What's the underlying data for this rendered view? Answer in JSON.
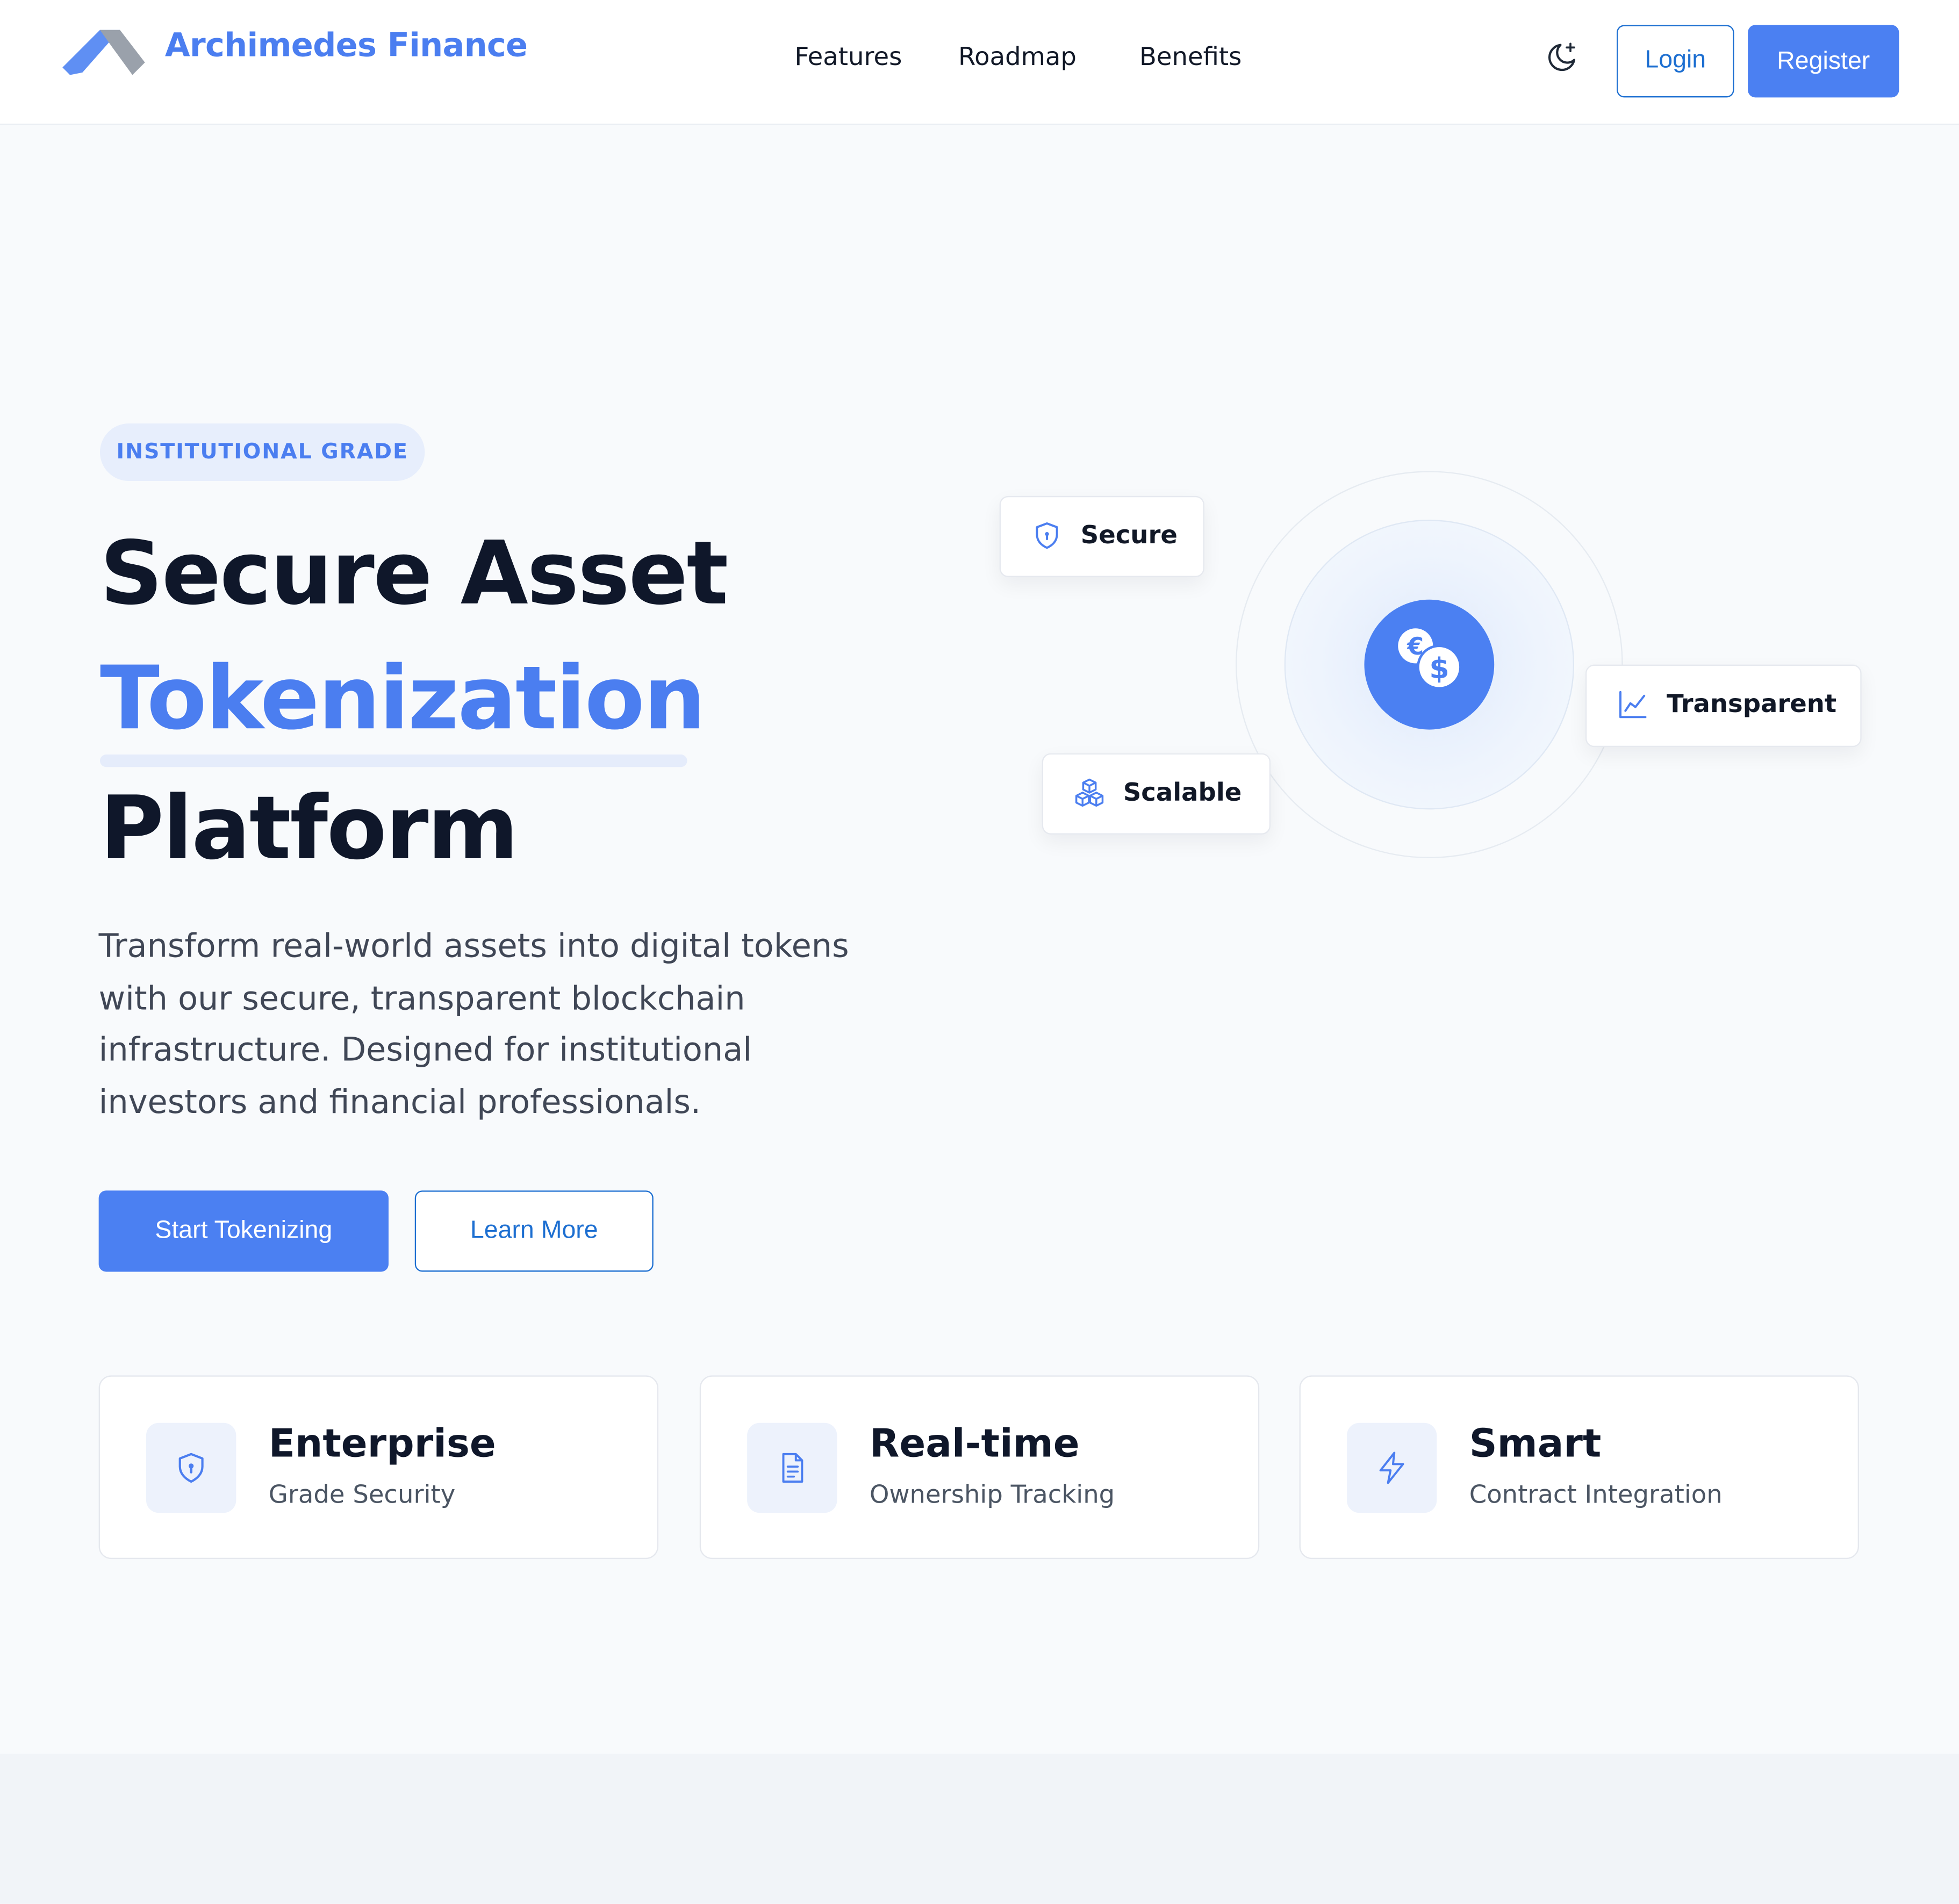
{
  "header": {
    "brand": "Archimedes Finance",
    "nav": [
      {
        "label": "Features"
      },
      {
        "label": "Roadmap"
      },
      {
        "label": "Benefits"
      }
    ],
    "theme_toggle_icon": "moon-sparkle-icon",
    "login_label": "Login",
    "register_label": "Register"
  },
  "hero": {
    "badge": "INSTITUTIONAL GRADE",
    "title_line1": "Secure Asset",
    "title_line2": "Tokenization",
    "title_line3": "Platform",
    "description": "Transform real-world assets into digital tokens with our secure, transparent blockchain infrastructure. Designed for institutional investors and financial professionals.",
    "primary_cta": "Start Tokenizing",
    "secondary_cta": "Learn More"
  },
  "illustration": {
    "center_icon": "currency-exchange-icon",
    "cards": [
      {
        "label": "Secure",
        "icon": "shield-icon"
      },
      {
        "label": "Transparent",
        "icon": "line-chart-icon"
      },
      {
        "label": "Scalable",
        "icon": "cubes-icon"
      }
    ]
  },
  "features": [
    {
      "title": "Enterprise",
      "subtitle": "Grade Security",
      "icon": "shield-lock-icon"
    },
    {
      "title": "Real-time",
      "subtitle": "Ownership Tracking",
      "icon": "document-icon"
    },
    {
      "title": "Smart",
      "subtitle": "Contract Integration",
      "icon": "lightning-icon"
    }
  ],
  "colors": {
    "accent": "#4b7ef0",
    "button_primary": "#4b80f2",
    "outline_button": "#1d6fd1",
    "heading": "#0f172a",
    "page_background": "#f8fafc"
  }
}
